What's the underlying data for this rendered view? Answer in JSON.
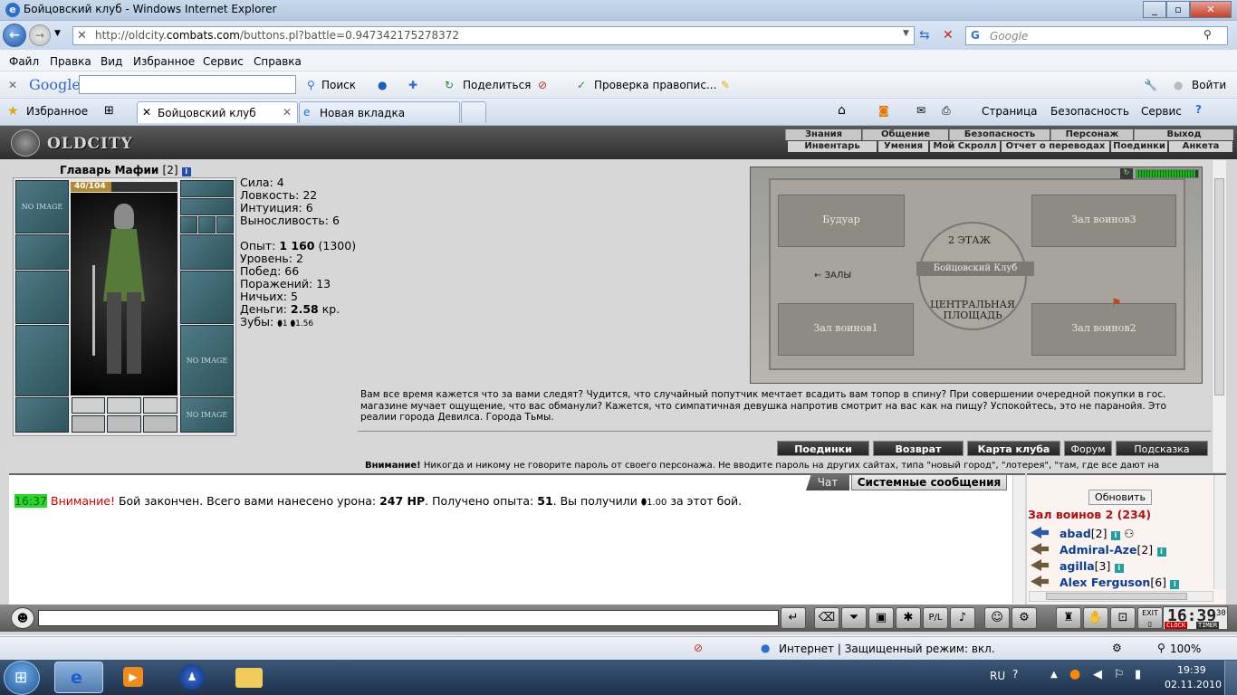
{
  "window": {
    "title": "Бойцовский клуб - Windows Internet Explorer"
  },
  "address": {
    "prefix": "http://oldcity.",
    "domain": "combats.com",
    "path": "/buttons.pl?battle=0.947342175278372",
    "search_placeholder": "Google"
  },
  "menu": [
    "Файл",
    "Правка",
    "Вид",
    "Избранное",
    "Сервис",
    "Справка"
  ],
  "google_toolbar": {
    "logo": "Google",
    "search": "Поиск",
    "share": "Поделиться",
    "spell": "Проверка правопис...",
    "signin": "Войти"
  },
  "tabs_bar": {
    "favorites": "Избранное",
    "tabs": [
      "Бойцовский клуб",
      "Новая вкладка"
    ],
    "page": "Страница",
    "safety": "Безопасность",
    "service": "Сервис"
  },
  "game_nav": {
    "logo": "OLDCITY",
    "top": [
      "Знания",
      "Общение",
      "Безопасность",
      "Персонаж",
      "Выход"
    ],
    "sub": [
      "Инвентарь",
      "Умения",
      "Мой Скролл",
      "Отчет о переводах",
      "Поединки",
      "Анкета"
    ]
  },
  "character": {
    "name": "Главарь Мафии",
    "level_tag": "[2]",
    "hp": "40/104",
    "no_image": "NO IMAGE",
    "stats": [
      {
        "label": "Сила:",
        "value": "4"
      },
      {
        "label": "Ловкость:",
        "value": "22"
      },
      {
        "label": "Интуиция:",
        "value": "6"
      },
      {
        "label": "Выносливость:",
        "value": "6"
      }
    ],
    "exp_label": "Опыт:",
    "exp_value": "1 160",
    "exp_next": "(1300)",
    "level_label": "Уровень:",
    "level_value": "2",
    "wins_label": "Побед:",
    "wins_value": "66",
    "losses_label": "Поражений:",
    "losses_value": "13",
    "draws_label": "Ничьих:",
    "draws_value": "5",
    "money_label": "Деньги:",
    "money_value": "2.58",
    "money_unit": "кр.",
    "teeth_label": "Зубы:",
    "teeth_a": "1",
    "teeth_b": "1.56"
  },
  "map": {
    "floor": "2 ЭТАЖ",
    "center_label": "Бойцовский Клуб",
    "halls": "ЗАЛЫ",
    "plaza": "ЦЕНТРАЛЬНАЯ ПЛОЩАДЬ",
    "rooms": [
      "Будуар",
      "Зал воинов3",
      "Зал воинов1",
      "Зал воинов2"
    ]
  },
  "description": "Вам все время кажется что за вами следят? Чудится, что случайный попутчик мечтает всадить вам топор в спину? При совершении очередной покупки в гос. магазине мучает ощущение, что вас обманули? Кажется, что симпатичная девушка напротив смотрит на вас как на пищу? Успокойтесь, это не паранойя. Это реалии города Девилса. Города Тьмы.",
  "game_buttons": [
    "Поединки",
    "Возврат",
    "Карта клуба",
    "Форум",
    "Подсказка"
  ],
  "warning": {
    "bold": "Внимание!",
    "text": " Никогда и никому не говорите пароль от своего персонажа. Не вводите пароль на других сайтах, типа \"новый город\", \"лотерея\", \"там, где все дают на"
  },
  "chat": {
    "tab_chat": "Чат",
    "tab_sys": "Системные сообщения",
    "time": "16:37",
    "attention": "Внимание!",
    "msg1": " Бой закончен. Всего вами нанесено урона: ",
    "damage": "247 HP",
    "msg2": ". Получено опыта: ",
    "exp": "51",
    "msg3": ". Вы получили ",
    "reward": "1.00",
    "msg4": " за этот бой."
  },
  "room_panel": {
    "refresh": "Обновить",
    "room": "Зал воинов 2 (234)",
    "players": [
      {
        "name": "abad",
        "level": "[2]"
      },
      {
        "name": "Admiral-Aze",
        "level": "[2]"
      },
      {
        "name": "agilla",
        "level": "[3]"
      },
      {
        "name": "Alex Ferguson",
        "level": "[6]"
      }
    ]
  },
  "clock": {
    "time": "16:39",
    "sec": "30",
    "clock_label": "CLOCK",
    "timer_label": "TIMER",
    "exit": "EXIT"
  },
  "statusbar": {
    "zone": "Интернет | Защищенный режим: вкл.",
    "zoom": "100%"
  },
  "taskbar": {
    "lang": "RU",
    "time": "19:39",
    "date": "02.11.2010"
  }
}
